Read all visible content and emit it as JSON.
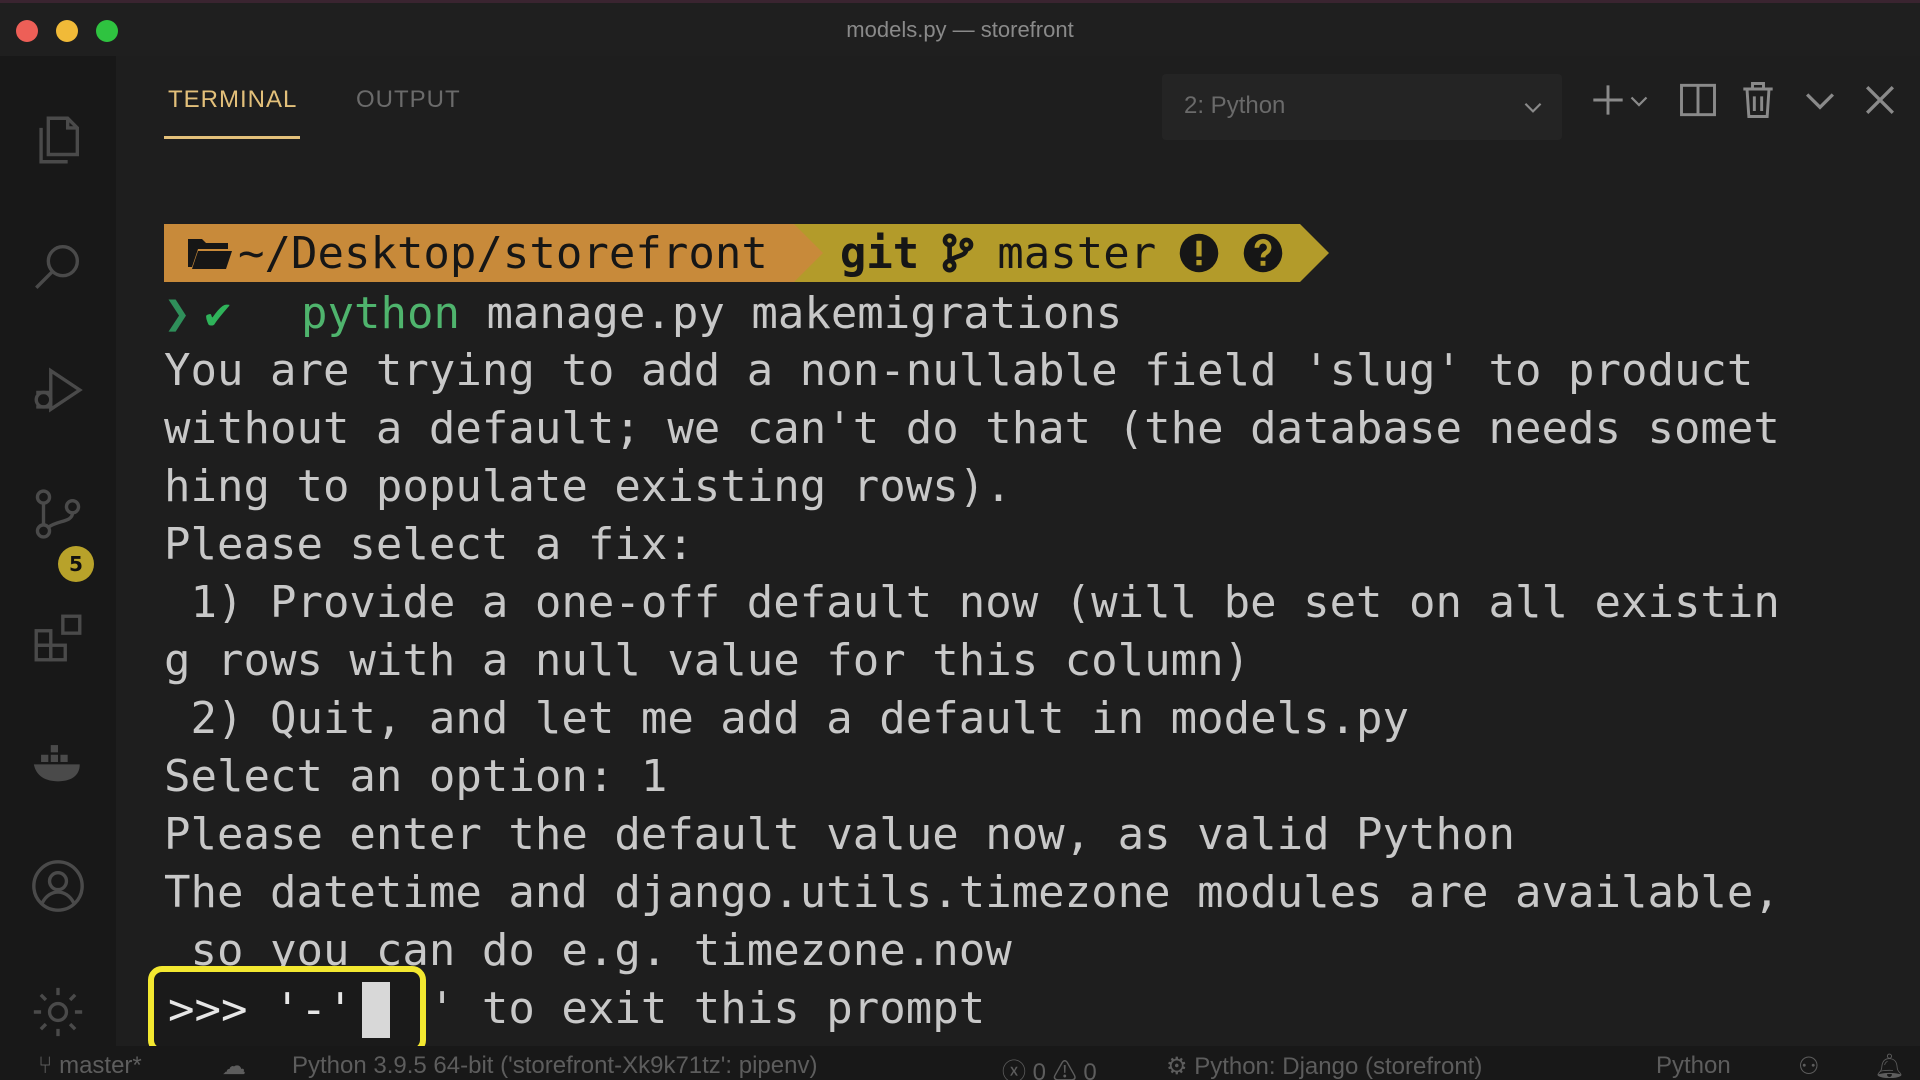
{
  "window": {
    "title": "models.py — storefront"
  },
  "activity_bar": {
    "items": [
      {
        "name": "explorer",
        "icon": "files-icon"
      },
      {
        "name": "search",
        "icon": "search-icon"
      },
      {
        "name": "run-debug",
        "icon": "debug-icon"
      },
      {
        "name": "source-control",
        "icon": "source-control-icon",
        "badge": "5"
      },
      {
        "name": "extensions",
        "icon": "extensions-icon"
      },
      {
        "name": "docker",
        "icon": "docker-icon"
      },
      {
        "name": "accounts",
        "icon": "account-icon"
      },
      {
        "name": "manage",
        "icon": "gear-icon"
      }
    ],
    "source_control_badge": "5"
  },
  "panel": {
    "tabs": [
      {
        "label": "TERMINAL",
        "active": true
      },
      {
        "label": "OUTPUT",
        "active": false
      }
    ],
    "terminal_selector": "2: Python"
  },
  "terminal": {
    "prompt": {
      "path": "~/Desktop/storefront",
      "git_label": "git",
      "branch": "master"
    },
    "command": {
      "program": "python",
      "args": " manage.py makemigrations"
    },
    "output_lines": [
      "You are trying to add a non-nullable field 'slug' to product",
      "without a default; we can't do that (the database needs somet",
      "hing to populate existing rows).",
      "Please select a fix:",
      " 1) Provide a one-off default now (will be set on all existin",
      "g rows with a null value for this column)",
      " 2) Quit, and let me add a default in models.py",
      "Select an option: 1",
      "Please enter the default value now, as valid Python",
      "The datetime and django.utils.timezone modules are available,",
      " so you can do e.g. timezone.now",
      "Type 'exit' to exit this prompt"
    ],
    "input": ">>> '-'"
  },
  "status_bar": {
    "branch": "master*",
    "interpreter": "Python 3.9.5 64-bit ('storefront-Xk9k71tz': pipenv)",
    "errors": "0",
    "warnings": "0",
    "debug_config": "Python: Django (storefront)",
    "language": "Python"
  },
  "colors": {
    "accent_tab": "#e3c07a",
    "prompt_path_bg": "#c88a3a",
    "prompt_git_bg": "#b39b2a",
    "highlight_box": "#f3e830",
    "python_keyword": "#4fb46d"
  }
}
